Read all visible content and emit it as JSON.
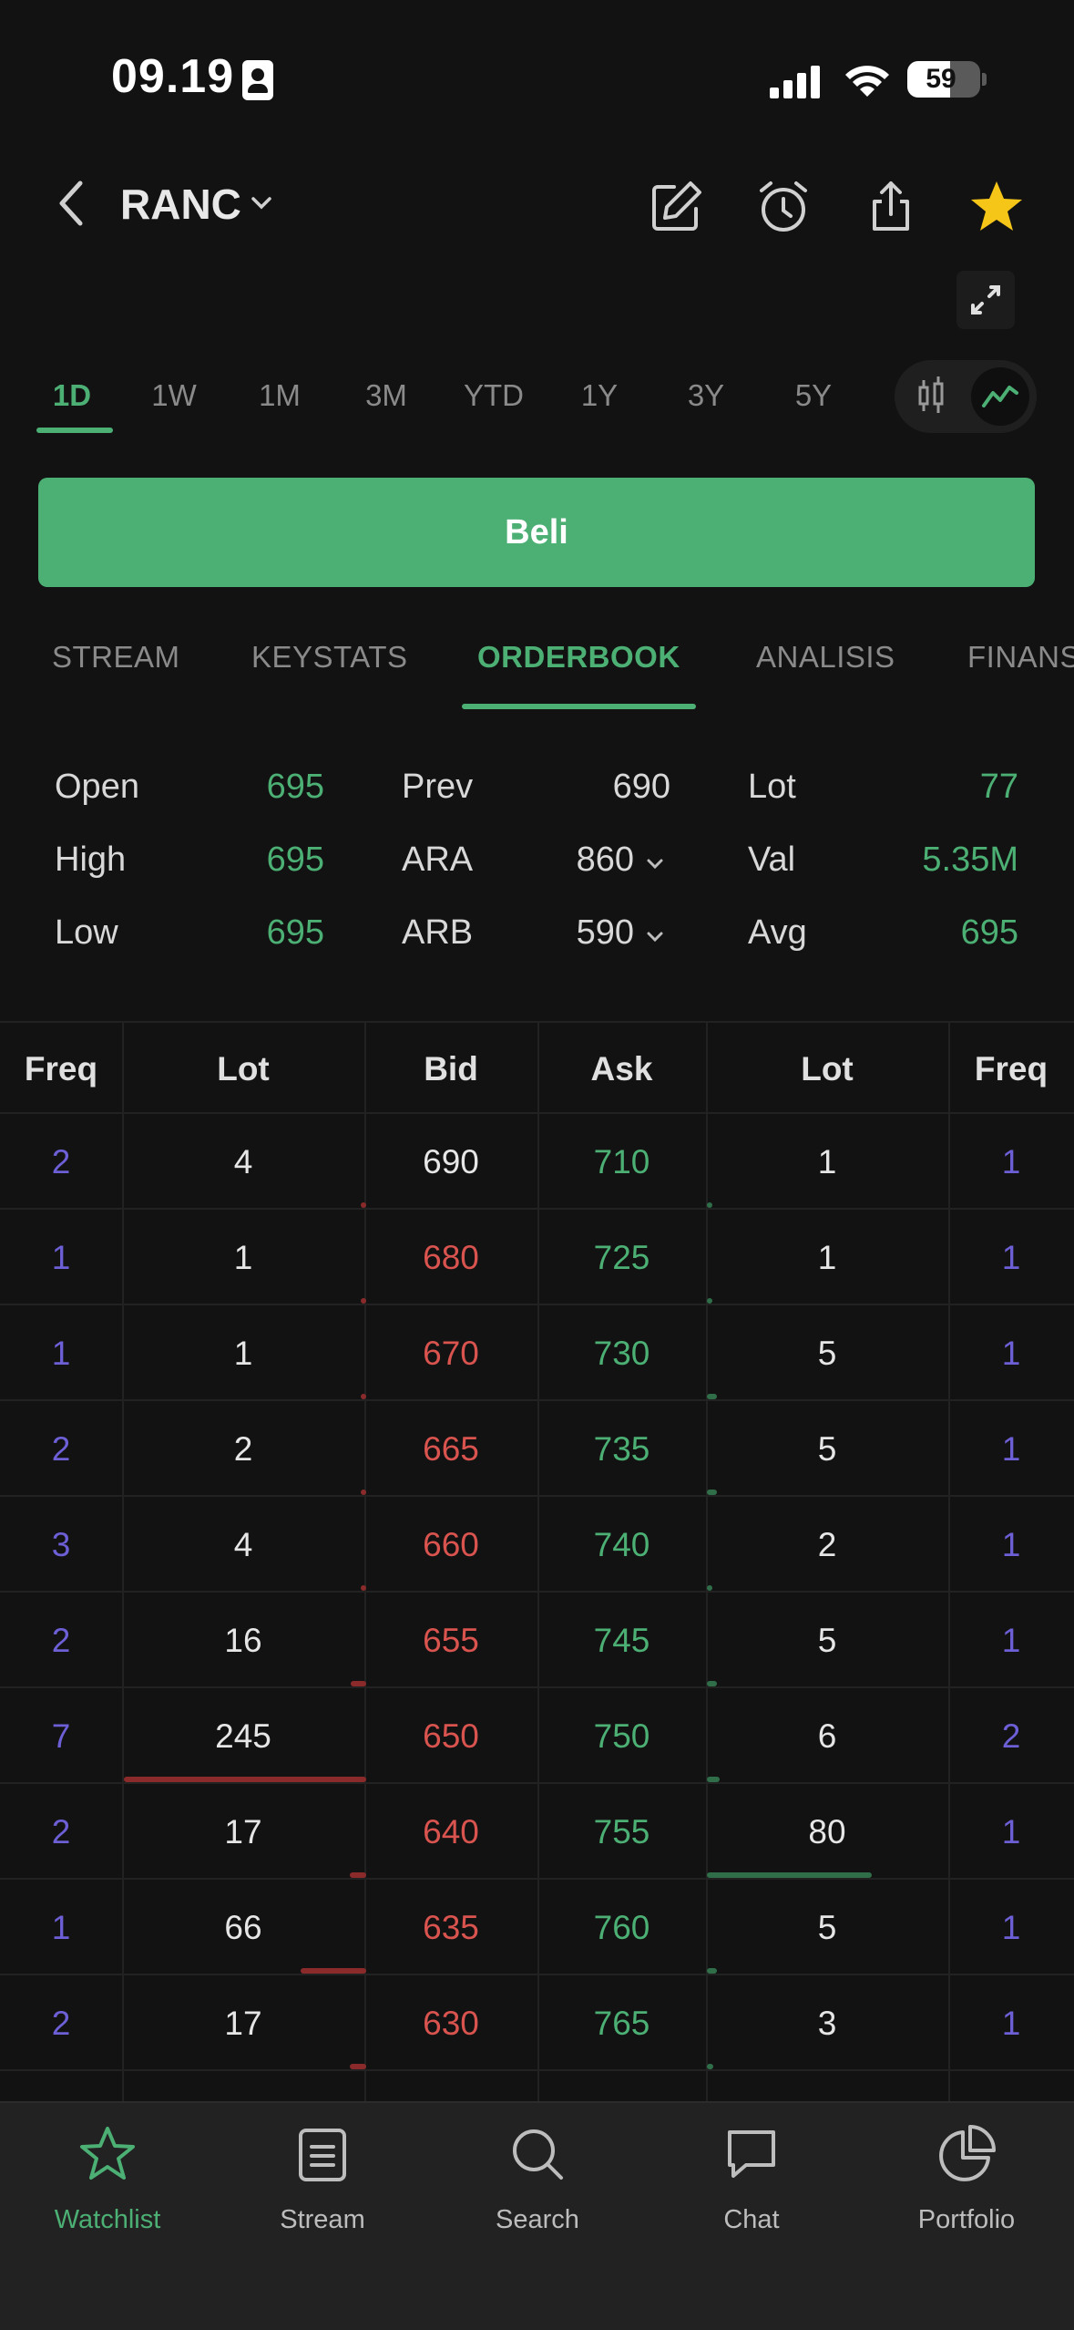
{
  "status_bar": {
    "time": "09.19",
    "battery": "59"
  },
  "header": {
    "ticker": "RANC"
  },
  "periods": [
    "1D",
    "1W",
    "1M",
    "3M",
    "YTD",
    "1Y",
    "3Y",
    "5Y"
  ],
  "active_period": "1D",
  "buy_label": "Beli",
  "sections": [
    "STREAM",
    "KEYSTATS",
    "ORDERBOOK",
    "ANALISIS",
    "FINANS"
  ],
  "active_section": "ORDERBOOK",
  "stats": {
    "open_label": "Open",
    "open": "695",
    "high_label": "High",
    "high": "695",
    "low_label": "Low",
    "low": "695",
    "prev_label": "Prev",
    "prev": "690",
    "ara_label": "ARA",
    "ara": "860",
    "arb_label": "ARB",
    "arb": "590",
    "lot_label": "Lot",
    "lot": "77",
    "val_label": "Val",
    "val": "5.35M",
    "avg_label": "Avg",
    "avg": "695"
  },
  "orderbook": {
    "headers": {
      "bid_freq": "Freq",
      "bid_lot": "Lot",
      "bid": "Bid",
      "ask": "Ask",
      "ask_lot": "Lot",
      "ask_freq": "Freq"
    },
    "rows": [
      {
        "bid_freq": "2",
        "bid_lot": "4",
        "bid": "690",
        "ask": "710",
        "ask_lot": "1",
        "ask_freq": "1"
      },
      {
        "bid_freq": "1",
        "bid_lot": "1",
        "bid": "680",
        "ask": "725",
        "ask_lot": "1",
        "ask_freq": "1"
      },
      {
        "bid_freq": "1",
        "bid_lot": "1",
        "bid": "670",
        "ask": "730",
        "ask_lot": "5",
        "ask_freq": "1"
      },
      {
        "bid_freq": "2",
        "bid_lot": "2",
        "bid": "665",
        "ask": "735",
        "ask_lot": "5",
        "ask_freq": "1"
      },
      {
        "bid_freq": "3",
        "bid_lot": "4",
        "bid": "660",
        "ask": "740",
        "ask_lot": "2",
        "ask_freq": "1"
      },
      {
        "bid_freq": "2",
        "bid_lot": "16",
        "bid": "655",
        "ask": "745",
        "ask_lot": "5",
        "ask_freq": "1"
      },
      {
        "bid_freq": "7",
        "bid_lot": "245",
        "bid": "650",
        "ask": "750",
        "ask_lot": "6",
        "ask_freq": "2"
      },
      {
        "bid_freq": "2",
        "bid_lot": "17",
        "bid": "640",
        "ask": "755",
        "ask_lot": "80",
        "ask_freq": "1"
      },
      {
        "bid_freq": "1",
        "bid_lot": "66",
        "bid": "635",
        "ask": "760",
        "ask_lot": "5",
        "ask_freq": "1"
      },
      {
        "bid_freq": "2",
        "bid_lot": "17",
        "bid": "630",
        "ask": "765",
        "ask_lot": "3",
        "ask_freq": "1"
      }
    ]
  },
  "nav": {
    "watchlist": "Watchlist",
    "stream": "Stream",
    "search": "Search",
    "chat": "Chat",
    "portfolio": "Portfolio"
  },
  "colors": {
    "accent": "#4caf74",
    "bid": "#d9534f",
    "freq": "#6d5fd6",
    "background": "#121212"
  }
}
